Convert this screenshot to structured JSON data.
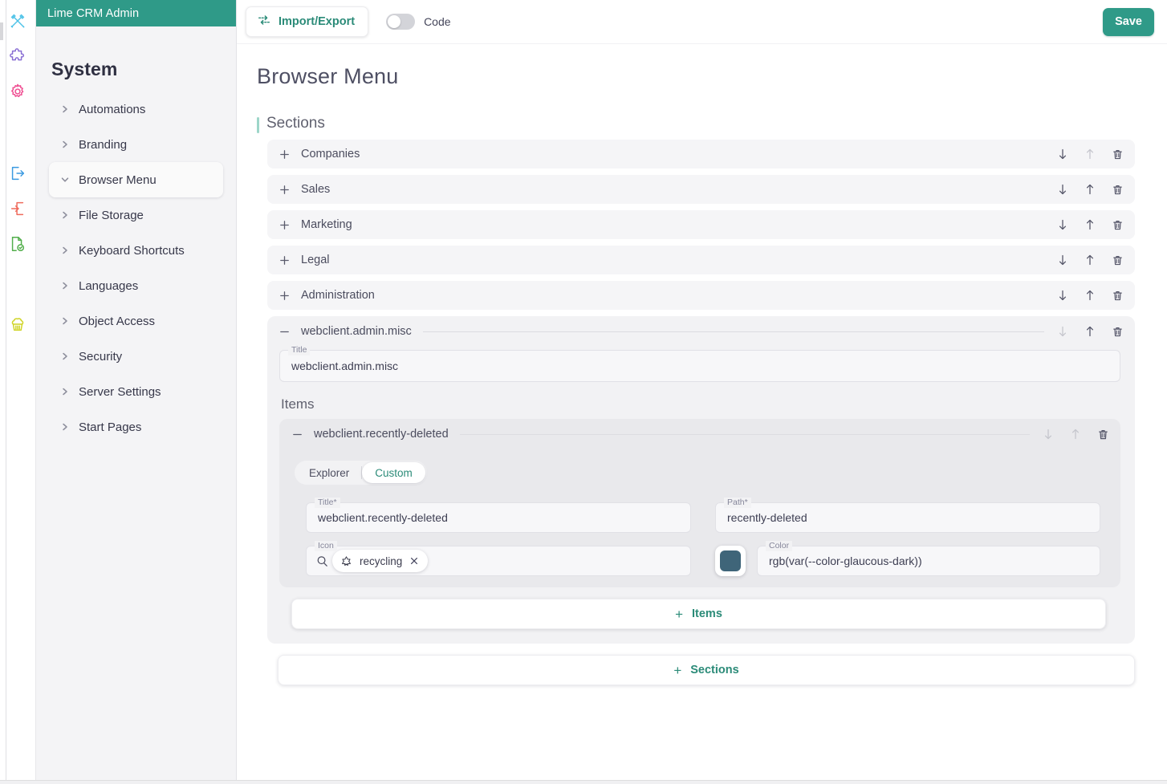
{
  "brand": {
    "title": "Lime CRM Admin",
    "accent": "#2f9a88"
  },
  "icon_rail": [
    {
      "name": "design-tools-icon",
      "color": "#4fc3e8"
    },
    {
      "name": "puzzle-piece-icon",
      "color": "#8a6fd4"
    },
    {
      "name": "gear-icon",
      "color": "#ef4b90"
    },
    {
      "name": "export-icon",
      "color": "#3b9ae1"
    },
    {
      "name": "import-icon",
      "color": "#ef6b5c"
    },
    {
      "name": "document-check-icon",
      "color": "#52ae4b"
    },
    {
      "name": "cupcake-icon",
      "color": "#cfd426"
    }
  ],
  "sidebar": {
    "title": "System",
    "items": [
      {
        "label": "Automations",
        "expanded": false
      },
      {
        "label": "Branding",
        "expanded": false
      },
      {
        "label": "Browser Menu",
        "expanded": true
      },
      {
        "label": "File Storage",
        "expanded": false
      },
      {
        "label": "Keyboard Shortcuts",
        "expanded": false
      },
      {
        "label": "Languages",
        "expanded": false
      },
      {
        "label": "Object Access",
        "expanded": false
      },
      {
        "label": "Security",
        "expanded": false
      },
      {
        "label": "Server Settings",
        "expanded": false
      },
      {
        "label": "Start Pages",
        "expanded": false
      }
    ]
  },
  "toolbar": {
    "import_export_label": "Import/Export",
    "code_toggle_label": "Code",
    "code_toggle_on": false,
    "save_label": "Save"
  },
  "page": {
    "title": "Browser Menu",
    "sections_group_label": "Sections",
    "sections": [
      {
        "label": "Companies",
        "expanded": false,
        "move_up_enabled": false,
        "move_down_enabled": true
      },
      {
        "label": "Sales",
        "expanded": false,
        "move_up_enabled": true,
        "move_down_enabled": true
      },
      {
        "label": "Marketing",
        "expanded": false,
        "move_up_enabled": true,
        "move_down_enabled": true
      },
      {
        "label": "Legal",
        "expanded": false,
        "move_up_enabled": true,
        "move_down_enabled": true
      },
      {
        "label": "Administration",
        "expanded": false,
        "move_up_enabled": true,
        "move_down_enabled": true
      }
    ],
    "expanded_section": {
      "label": "webclient.admin.misc",
      "move_up_enabled": true,
      "move_down_enabled": false,
      "title_field": {
        "label": "Title",
        "value": "webclient.admin.misc"
      },
      "items_label": "Items",
      "item": {
        "label": "webclient.recently-deleted",
        "move_up_enabled": false,
        "move_down_enabled": false,
        "source_tabs": [
          {
            "label": "Explorer",
            "active": false
          },
          {
            "label": "Custom",
            "active": true
          }
        ],
        "fields": {
          "title": {
            "label": "Title*",
            "value": "webclient.recently-deleted"
          },
          "path": {
            "label": "Path*",
            "value": "recently-deleted"
          },
          "icon": {
            "label": "Icon",
            "chip_label": "recycling",
            "search_placeholder": ""
          },
          "color": {
            "label": "Color",
            "value": "rgb(var(--color-glaucous-dark))",
            "swatch": "#3f6579"
          }
        }
      }
    },
    "add_items_label": "Items",
    "add_sections_label": "Sections"
  }
}
